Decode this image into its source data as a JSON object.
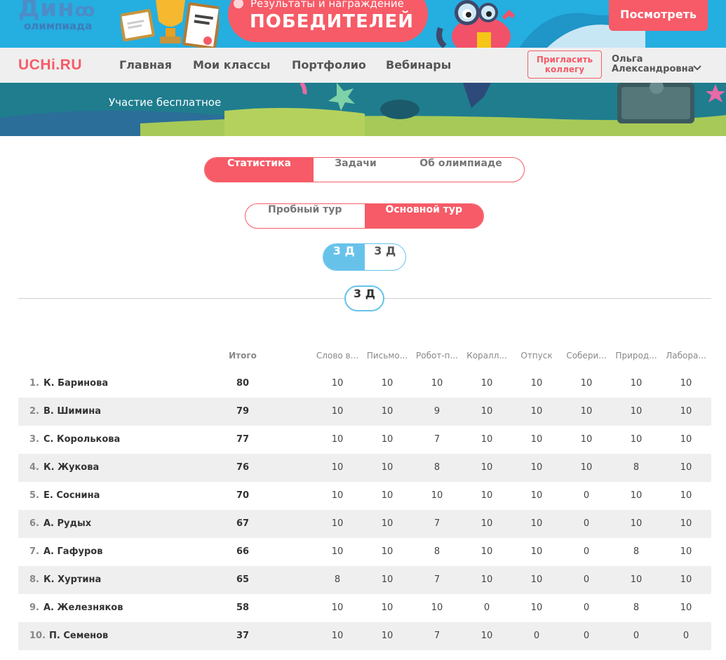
{
  "promo": {
    "logo": "Дин",
    "logo_sub": "олимпиада",
    "line1": "Результаты и награждение",
    "line2": "ПОБЕДИТЕЛЕЙ",
    "button": "Посмотреть"
  },
  "nav": {
    "brand": "UCHi.RU",
    "items": [
      "Главная",
      "Мои классы",
      "Портфолио",
      "Вебинары"
    ],
    "invite": "Пригласить коллегу",
    "user_first": "Ольга",
    "user_last": "Александровна"
  },
  "hero": {
    "text": "Участие бесплатное"
  },
  "tabs": [
    "Статистика",
    "Задачи",
    "Об олимпиаде"
  ],
  "active_tab": 0,
  "tours": [
    "Пробный тур",
    "Основной тур"
  ],
  "active_tour": 1,
  "classes": [
    "3 Д",
    "3 Д"
  ],
  "active_class": 0,
  "class_badge": "3 Д",
  "table": {
    "total_header": "Итого",
    "columns": [
      "Слово в...",
      "Письмо...",
      "Робот-п...",
      "Коралл...",
      "Отпуск",
      "Собери...",
      "Природ...",
      "Лабора..."
    ],
    "rows": [
      {
        "rank": "1.",
        "name": "К. Баринова",
        "total": "80",
        "scores": [
          "10",
          "10",
          "10",
          "10",
          "10",
          "10",
          "10",
          "10"
        ]
      },
      {
        "rank": "2.",
        "name": "В. Шимина",
        "total": "79",
        "scores": [
          "10",
          "10",
          "9",
          "10",
          "10",
          "10",
          "10",
          "10"
        ]
      },
      {
        "rank": "3.",
        "name": "С. Королькова",
        "total": "77",
        "scores": [
          "10",
          "10",
          "7",
          "10",
          "10",
          "10",
          "10",
          "10"
        ]
      },
      {
        "rank": "4.",
        "name": "К. Жукова",
        "total": "76",
        "scores": [
          "10",
          "10",
          "8",
          "10",
          "10",
          "10",
          "8",
          "10"
        ]
      },
      {
        "rank": "5.",
        "name": "Е. Соснина",
        "total": "70",
        "scores": [
          "10",
          "10",
          "10",
          "10",
          "10",
          "0",
          "10",
          "10"
        ]
      },
      {
        "rank": "6.",
        "name": "А. Рудых",
        "total": "67",
        "scores": [
          "10",
          "10",
          "7",
          "10",
          "10",
          "0",
          "10",
          "10"
        ]
      },
      {
        "rank": "7.",
        "name": "А. Гафуров",
        "total": "66",
        "scores": [
          "10",
          "10",
          "8",
          "10",
          "10",
          "0",
          "8",
          "10"
        ]
      },
      {
        "rank": "8.",
        "name": "К. Хуртина",
        "total": "65",
        "scores": [
          "8",
          "10",
          "7",
          "10",
          "10",
          "0",
          "10",
          "10"
        ]
      },
      {
        "rank": "9.",
        "name": "А. Железняков",
        "total": "58",
        "scores": [
          "10",
          "10",
          "10",
          "0",
          "10",
          "0",
          "8",
          "10"
        ]
      },
      {
        "rank": "10.",
        "name": "П. Семенов",
        "total": "37",
        "scores": [
          "10",
          "10",
          "7",
          "10",
          "0",
          "0",
          "0",
          "0"
        ]
      }
    ]
  },
  "colors": {
    "accent": "#f65b67",
    "blue": "#67c2ea",
    "banner": "#25aee0"
  }
}
